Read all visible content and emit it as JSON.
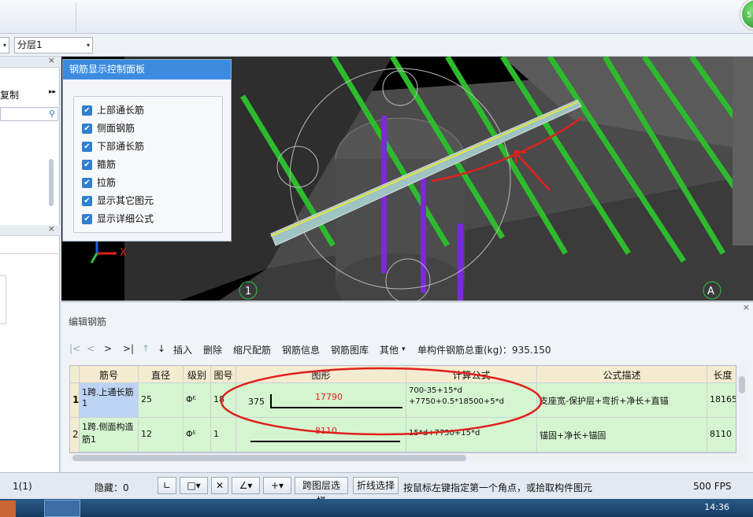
{
  "toolbar2": {
    "combo_left": "",
    "layer_combo": "分层1"
  },
  "left_panel": {
    "copy_label": "复制",
    "close_glyph": "×"
  },
  "control_panel": {
    "title": "钢筋显示控制面板",
    "options": [
      {
        "label": "上部通长筋",
        "checked": true
      },
      {
        "label": "侧面钢筋",
        "checked": true
      },
      {
        "label": "下部通长筋",
        "checked": true
      },
      {
        "label": "箍筋",
        "checked": true
      },
      {
        "label": "拉筋",
        "checked": true
      },
      {
        "label": "显示其它图元",
        "checked": true
      },
      {
        "label": "显示详细公式",
        "checked": true
      }
    ]
  },
  "viewport": {
    "axis_label_1": "1",
    "axis_label_a": "A",
    "axis_x": "X"
  },
  "edit_panel": {
    "title": "编辑钢筋",
    "toolbar": {
      "nav_first": "|<",
      "nav_prev": "<",
      "nav_next": ">",
      "nav_last": ">|",
      "up": "↑",
      "down": "↓",
      "insert": "插入",
      "delete": "删除",
      "scale": "缩尺配筋",
      "info": "钢筋信息",
      "library": "钢筋图库",
      "other": "其他",
      "total": "单构件钢筋总重(kg)：935.150"
    },
    "columns": [
      "筋号",
      "直径(mm)",
      "级别",
      "图号",
      "图形",
      "计算公式",
      "公式描述",
      "长度"
    ],
    "rows": [
      {
        "index": "1",
        "name": "1跨.上通长筋1",
        "diameter": "25",
        "grade": "Φᴱ",
        "fig_no": "18",
        "shape_left": "375",
        "shape_value": "17790",
        "formula_1": "700-35+15*d",
        "formula_2": "+7750+0.5*18500+5*d",
        "description": "支座宽-保护层+弯折+净长+直锚",
        "length": "18165"
      },
      {
        "index": "2",
        "name": "1跨.侧面构造筋1",
        "diameter": "12",
        "grade": "Φᴱ",
        "fig_no": "1",
        "shape_left": "",
        "shape_value": "8110",
        "formula_1": "15*d+7750+15*d",
        "formula_2": "",
        "description": "锚固+净长+锚固",
        "length": "8110"
      }
    ]
  },
  "status": {
    "position": "1(1)",
    "hidden": "隐藏：0",
    "cross_layer": "跨图层选择",
    "polyline": "折线选择",
    "hint": "按鼠标左键指定第一个角点，或拾取构件图元",
    "fps": "500 FPS"
  },
  "taskbar": {
    "time": "14:36"
  },
  "colors": {
    "accent": "#3c8be0",
    "row_green": "#d5f5d0",
    "header": "#f4ecd0",
    "annot_red": "#e0201c"
  }
}
